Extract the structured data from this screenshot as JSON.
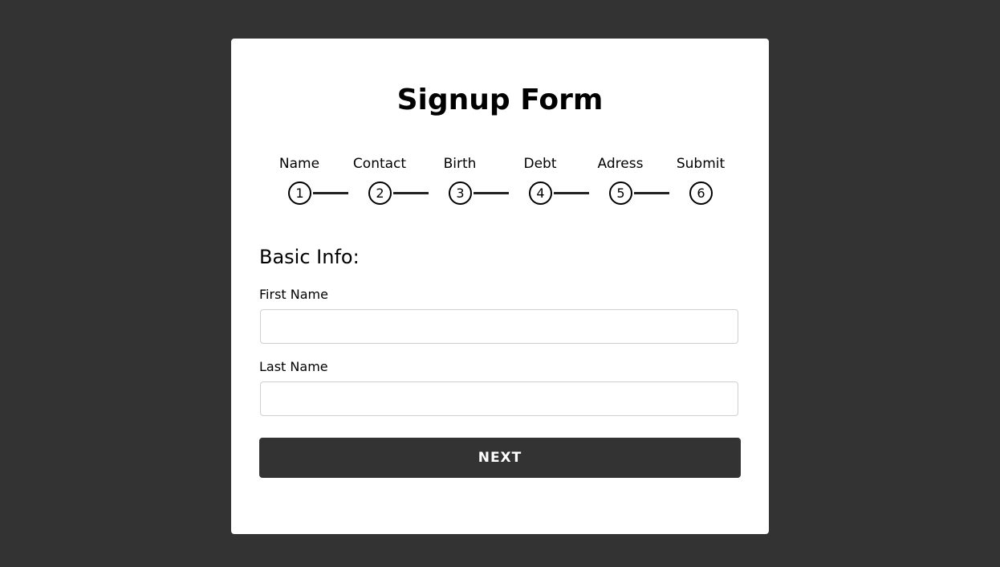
{
  "form": {
    "title": "Signup Form",
    "steps": [
      {
        "label": "Name",
        "number": "1"
      },
      {
        "label": "Contact",
        "number": "2"
      },
      {
        "label": "Birth",
        "number": "3"
      },
      {
        "label": "Debt",
        "number": "4"
      },
      {
        "label": "Adress",
        "number": "5"
      },
      {
        "label": "Submit",
        "number": "6"
      }
    ],
    "section_title": "Basic Info:",
    "fields": [
      {
        "label": "First Name",
        "value": ""
      },
      {
        "label": "Last Name",
        "value": ""
      }
    ],
    "next_label": "NEXT"
  },
  "colors": {
    "background": "#333333",
    "card": "#ffffff",
    "button": "#333333"
  }
}
